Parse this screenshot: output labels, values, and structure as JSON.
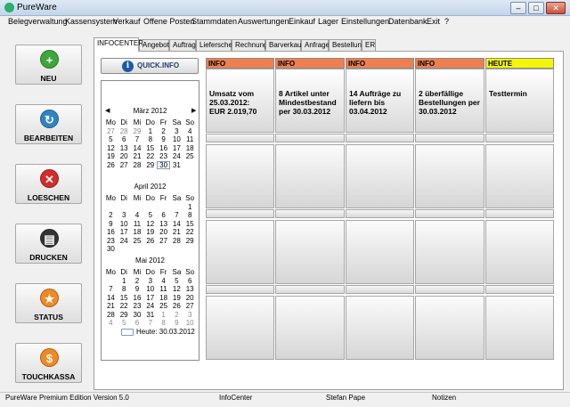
{
  "window": {
    "title": "PureWare"
  },
  "menu": [
    "Belegverwaltung",
    "Kassensystem",
    "Verkauf",
    "Offene Posten",
    "Stammdaten",
    "Auswertungen",
    "Einkauf",
    "Lager",
    "Einstellungen",
    "Datenbank",
    "Exit",
    "?"
  ],
  "sidebar": [
    {
      "label": "NEU",
      "icon": "plus-icon",
      "glyph": "+",
      "color": "#3ea63a"
    },
    {
      "label": "BEARBEITEN",
      "icon": "refresh-icon",
      "glyph": "↻",
      "color": "#2f85c4"
    },
    {
      "label": "LOESCHEN",
      "icon": "delete-icon",
      "glyph": "✕",
      "color": "#d22c2c"
    },
    {
      "label": "DRUCKEN",
      "icon": "printer-icon",
      "glyph": "▤",
      "color": "#333333"
    },
    {
      "label": "STATUS",
      "icon": "star-icon",
      "glyph": "★",
      "color": "#f08a24"
    },
    {
      "label": "TOUCHKASSA",
      "icon": "dollar-icon",
      "glyph": "$",
      "color": "#f08a24"
    }
  ],
  "tabs": [
    "INFOCENTER",
    "Angebot",
    "Auftrag",
    "Lieferschein",
    "Rechnung",
    "Barverkauf",
    "Anfrage",
    "Bestellung",
    "ER"
  ],
  "active_tab": "INFOCENTER",
  "quickinfo": {
    "label": "QUICK.INFO",
    "icon": "info-icon"
  },
  "calendar": {
    "weekdays": [
      "Mo",
      "Di",
      "Mi",
      "Do",
      "Fr",
      "Sa",
      "So"
    ],
    "months": [
      {
        "title": "März 2012",
        "rows": [
          [
            "27",
            "28",
            "29",
            "1",
            "2",
            "3",
            "4"
          ],
          [
            "5",
            "6",
            "7",
            "8",
            "9",
            "10",
            "11"
          ],
          [
            "12",
            "13",
            "14",
            "15",
            "16",
            "17",
            "18"
          ],
          [
            "19",
            "20",
            "21",
            "22",
            "23",
            "24",
            "25"
          ],
          [
            "26",
            "27",
            "28",
            "29",
            "30",
            "31",
            ""
          ]
        ]
      },
      {
        "title": "April 2012",
        "rows": [
          [
            "",
            "",
            "",
            "",
            "",
            "",
            "1"
          ],
          [
            "2",
            "3",
            "4",
            "5",
            "6",
            "7",
            "8"
          ],
          [
            "9",
            "10",
            "11",
            "12",
            "13",
            "14",
            "15"
          ],
          [
            "16",
            "17",
            "18",
            "19",
            "20",
            "21",
            "22"
          ],
          [
            "23",
            "24",
            "25",
            "26",
            "27",
            "28",
            "29"
          ],
          [
            "30",
            "",
            "",
            "",
            "",
            "",
            ""
          ]
        ]
      },
      {
        "title": "Mai 2012",
        "rows": [
          [
            "",
            "1",
            "2",
            "3",
            "4",
            "5",
            "6"
          ],
          [
            "7",
            "8",
            "9",
            "10",
            "11",
            "12",
            "13"
          ],
          [
            "14",
            "15",
            "16",
            "17",
            "18",
            "19",
            "20"
          ],
          [
            "21",
            "22",
            "23",
            "24",
            "25",
            "26",
            "27"
          ],
          [
            "28",
            "29",
            "30",
            "31",
            "1",
            "2",
            "3"
          ],
          [
            "4",
            "5",
            "6",
            "7",
            "8",
            "9",
            "10"
          ]
        ]
      }
    ],
    "selected_day": "30",
    "today_label": "Heute: 30.03.2012"
  },
  "cards": [
    {
      "header": "INFO",
      "color": "#ef7f4f",
      "text": [
        "Umsatz vom",
        "25.03.2012:",
        "EUR 2.019,70"
      ]
    },
    {
      "header": "INFO",
      "color": "#ef7f4f",
      "text": [
        "8 Artikel unter",
        "Mindestbestand",
        "per 30.03.2012"
      ]
    },
    {
      "header": "INFO",
      "color": "#ef7f4f",
      "text": [
        "14 Aufträge zu",
        "liefern bis",
        "03.04.2012"
      ]
    },
    {
      "header": "INFO",
      "color": "#ef7f4f",
      "text": [
        "2 überfällige",
        "Bestellungen per",
        "30.03.2012"
      ]
    },
    {
      "header": "HEUTE",
      "color": "#f5f507",
      "text": [
        "Testtermin"
      ]
    }
  ],
  "statusbar": {
    "version": "PureWare Premium Edition Version 5.0",
    "module": "InfoCenter",
    "user": "Stefan Pape",
    "notes": "Notizen"
  }
}
